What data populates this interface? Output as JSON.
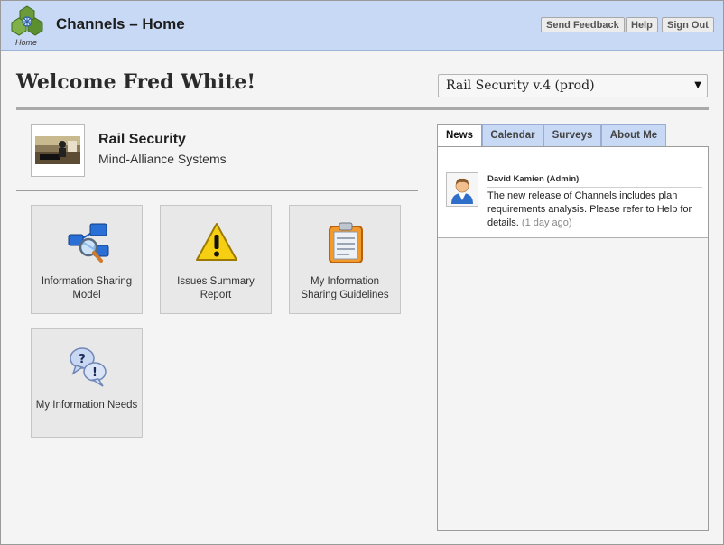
{
  "header": {
    "title": "Channels – Home",
    "home_label": "Home",
    "buttons": [
      "Send Feedback",
      "Help",
      "Sign Out"
    ]
  },
  "welcome": "Welcome Fred White!",
  "plan_selector": {
    "selected": "Rail Security v.4 (prod)"
  },
  "organization": {
    "name": "Rail Security",
    "subtitle": "Mind-Alliance Systems"
  },
  "tiles": [
    {
      "label": "Information Sharing Model",
      "icon": "network-search-icon"
    },
    {
      "label": "Issues Summary Report",
      "icon": "warning-icon"
    },
    {
      "label": "My Information Sharing Guidelines",
      "icon": "clipboard-icon"
    },
    {
      "label": "My Information Needs",
      "icon": "question-exclamation-bubbles-icon"
    }
  ],
  "tabs": [
    "News",
    "Calendar",
    "Surveys",
    "About Me"
  ],
  "active_tab": "News",
  "news": [
    {
      "author": "David Kamien (Admin)",
      "text": "The new release of Channels includes plan requirements analysis. Please refer to Help for details.",
      "age": "(1 day ago)"
    }
  ],
  "colors": {
    "header_bg": "#c8d9f5",
    "tab_bg": "#c8d9f5",
    "page_bg": "#f4f4f4"
  }
}
